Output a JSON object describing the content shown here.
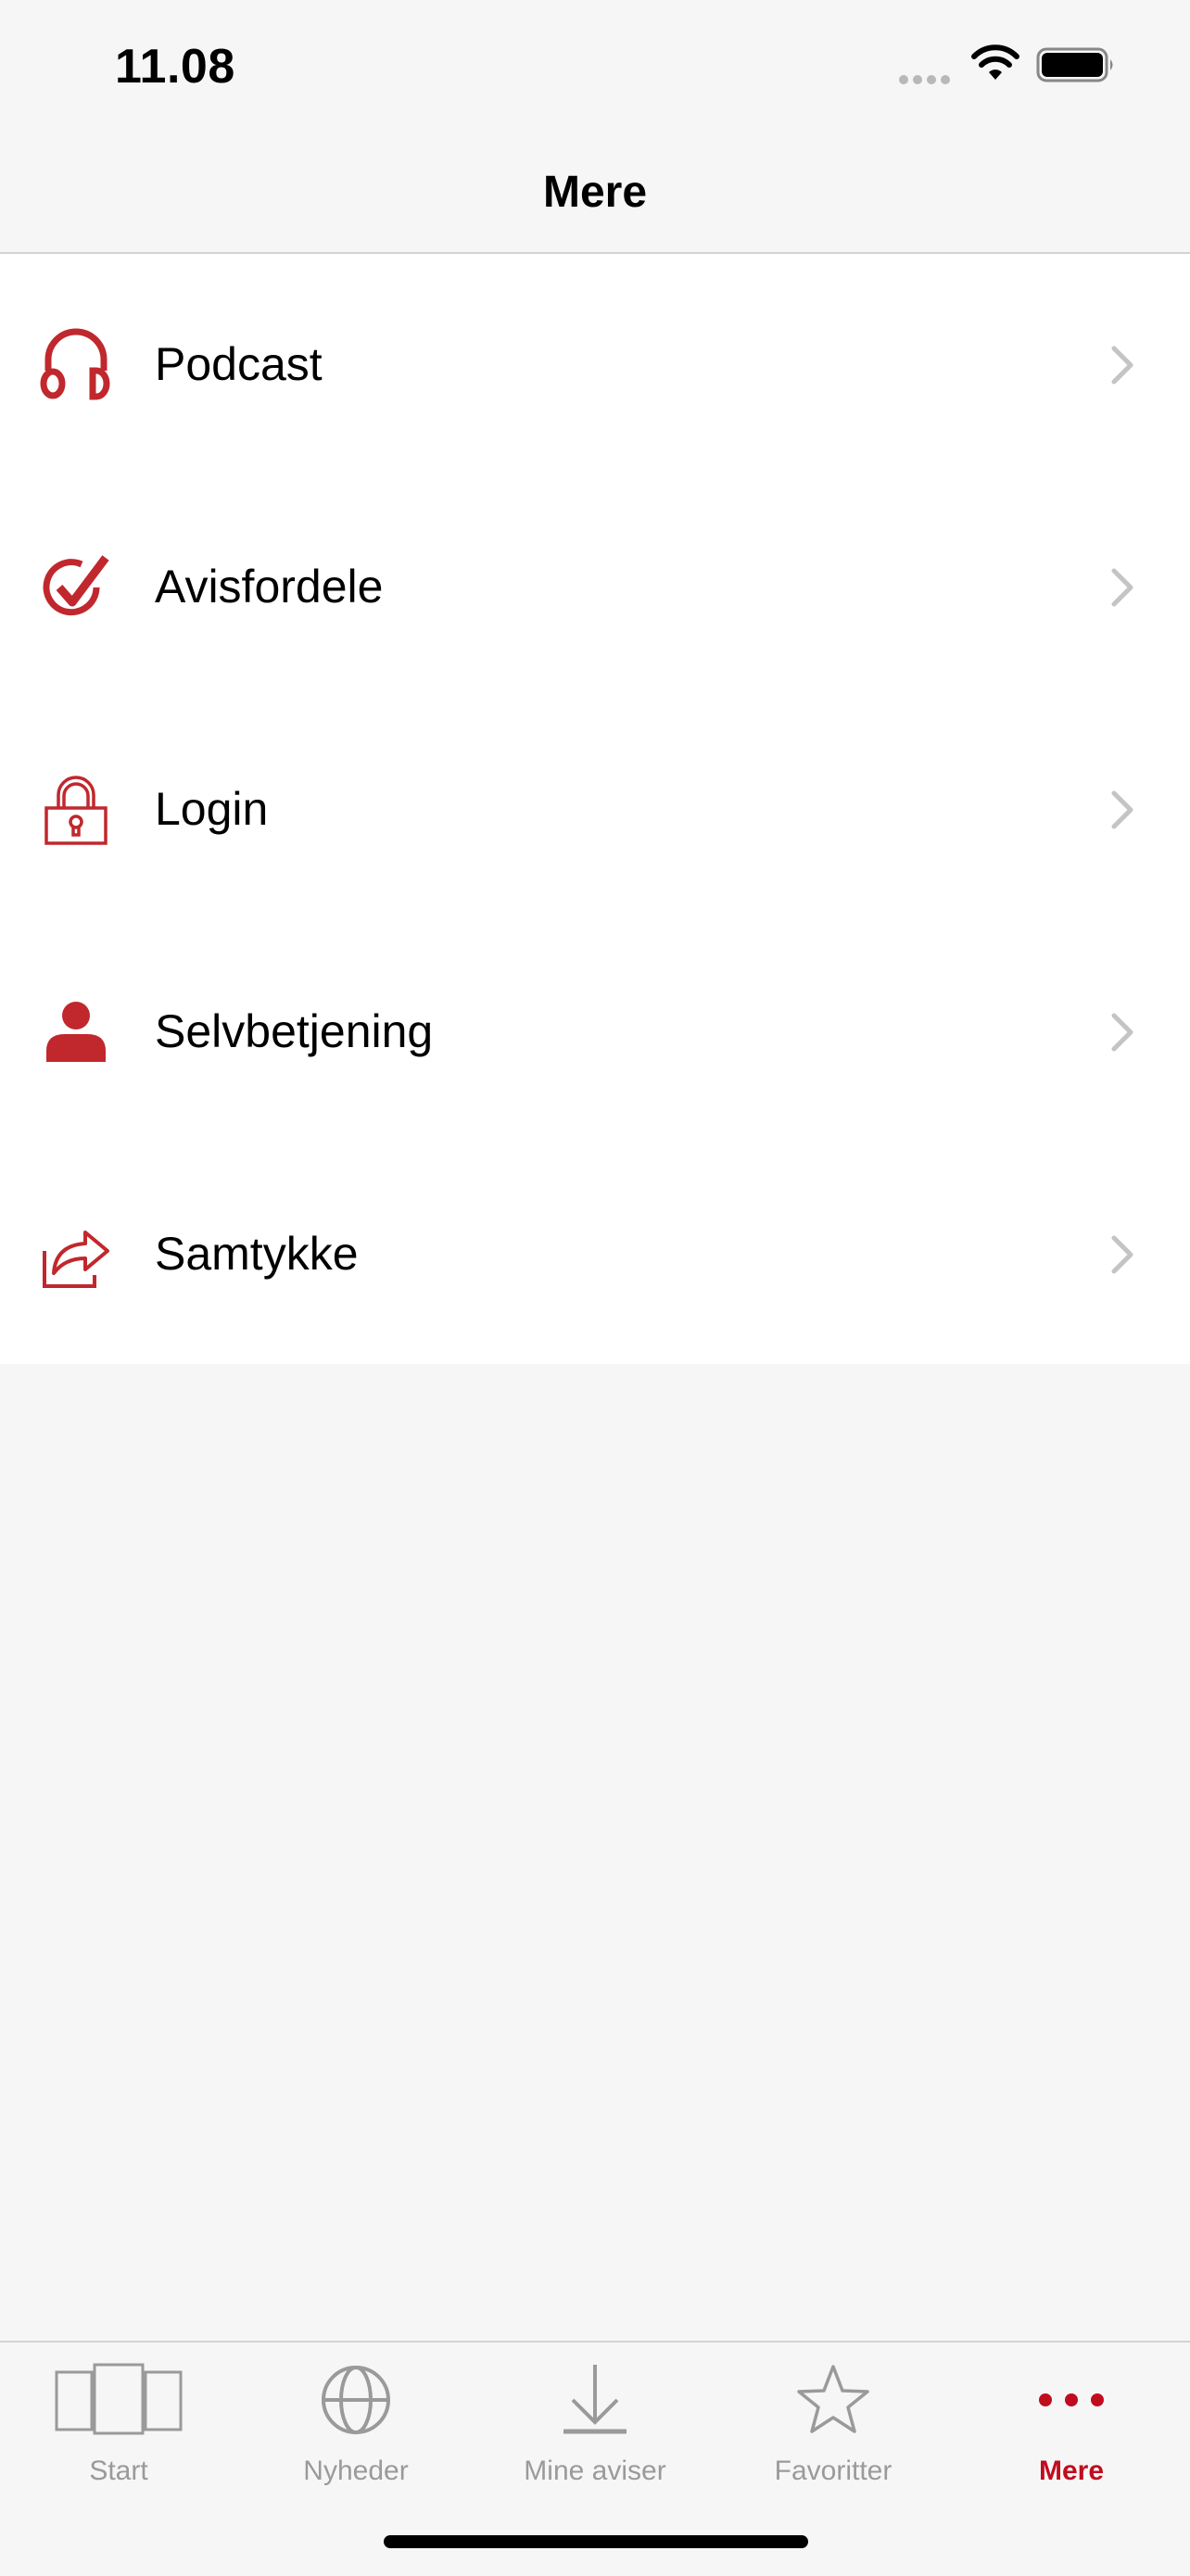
{
  "status_bar": {
    "time": "11.08",
    "icons": [
      "signal-dots-icon",
      "wifi-icon",
      "battery-icon"
    ]
  },
  "nav": {
    "title": "Mere"
  },
  "menu": {
    "items": [
      {
        "label": "Podcast",
        "icon": "headphones-icon"
      },
      {
        "label": "Avisfordele",
        "icon": "check-circle-icon"
      },
      {
        "label": "Login",
        "icon": "padlock-icon"
      },
      {
        "label": "Selvbetjening",
        "icon": "person-icon"
      },
      {
        "label": "Samtykke",
        "icon": "share-arrow-icon"
      }
    ],
    "chevron_icon": "chevron-right-icon"
  },
  "tabbar": {
    "tabs": [
      {
        "label": "Start",
        "icon": "pages-icon",
        "active": false
      },
      {
        "label": "Nyheder",
        "icon": "globe-icon",
        "active": false
      },
      {
        "label": "Mine aviser",
        "icon": "download-icon",
        "active": false
      },
      {
        "label": "Favoritter",
        "icon": "star-icon",
        "active": false
      },
      {
        "label": "Mere",
        "icon": "more-dots-icon",
        "active": true
      }
    ]
  },
  "colors": {
    "accent": "#c0282d",
    "tab_active": "#c00d1e",
    "tab_inactive": "#9a9a9a",
    "background": "#f6f6f6"
  }
}
